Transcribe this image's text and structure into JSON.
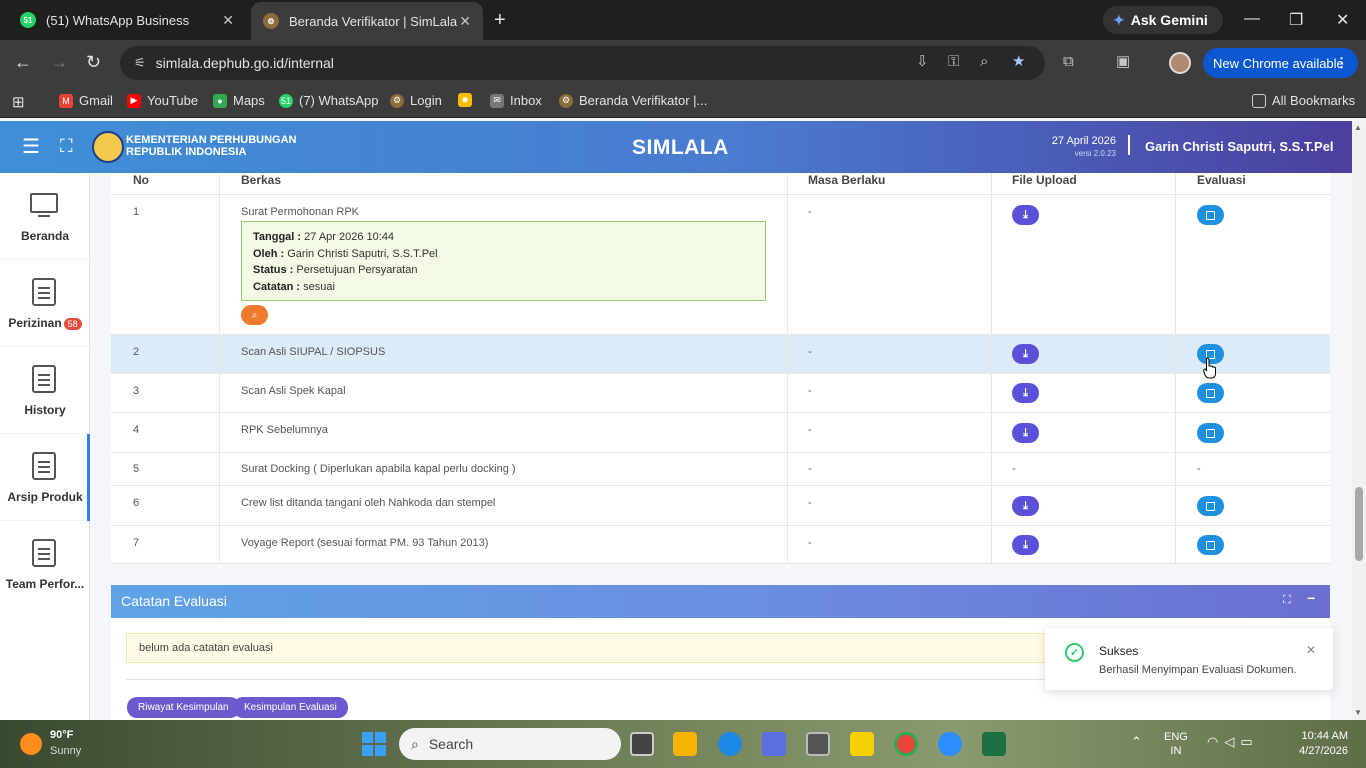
{
  "browser": {
    "tabs": [
      {
        "title": "(51) WhatsApp Business",
        "favicon_text": "51",
        "favicon_color": "#25d366"
      },
      {
        "title": "Beranda Verifikator | SimLala",
        "favicon_color": "#8a6d3b"
      }
    ],
    "ask_gemini": "Ask Gemini",
    "url": "simlala.dephub.go.id/internal",
    "update_label": "New Chrome available",
    "bookmarks": [
      {
        "label": "Gmail",
        "color": "#ea4335"
      },
      {
        "label": "YouTube",
        "color": "#ff0000"
      },
      {
        "label": "Maps",
        "color": "#34a853"
      },
      {
        "label": "(7) WhatsApp",
        "color": "#25d366",
        "badge": "51"
      },
      {
        "label": "Login",
        "color": "#8a6d3b"
      },
      {
        "label": "",
        "color": "#fbbc04"
      },
      {
        "label": "Inbox",
        "color": "#888888"
      },
      {
        "label": "Beranda Verifikator |...",
        "color": "#8a6d3b"
      }
    ],
    "all_bookmarks": "All Bookmarks"
  },
  "header": {
    "ministry_line1": "KEMENTERIAN PERHUBUNGAN",
    "ministry_line2": "REPUBLIK INDONESIA",
    "title": "SIMLALA",
    "date": "27 April 2026",
    "version": "versi 2.0.23",
    "user": "Garin Christi Saputri, S.S.T.Pel"
  },
  "sidebar": {
    "items": [
      {
        "label": "Beranda"
      },
      {
        "label": "Perizinan",
        "badge": "58"
      },
      {
        "label": "History"
      },
      {
        "label": "Arsip Produk"
      },
      {
        "label": "Team Perfor..."
      }
    ]
  },
  "table": {
    "columns": [
      "No",
      "Berkas",
      "Masa Berlaku",
      "File Upload",
      "Evaluasi"
    ],
    "rows": [
      {
        "no": "1",
        "berkas": "Surat Permohonan RPK",
        "masa": "-",
        "has_upload": true,
        "has_eval": true
      },
      {
        "no": "2",
        "berkas": "Scan Asli SIUPAL / SIOPSUS",
        "masa": "-",
        "has_upload": true,
        "has_eval": true
      },
      {
        "no": "3",
        "berkas": "Scan Asli Spek Kapal",
        "masa": "-",
        "has_upload": true,
        "has_eval": true
      },
      {
        "no": "4",
        "berkas": "RPK Sebelumnya",
        "masa": "-",
        "has_upload": true,
        "has_eval": true
      },
      {
        "no": "5",
        "berkas": "Surat Docking ( Diperlukan apabila kapal perlu docking )",
        "masa": "-",
        "upload_text": "-",
        "eval_text": "-"
      },
      {
        "no": "6",
        "berkas": "Crew list ditanda tangani oleh Nahkoda dan stempel",
        "masa": "-",
        "has_upload": true,
        "has_eval": true
      },
      {
        "no": "7",
        "berkas": "Voyage Report (sesuai format PM. 93 Tahun 2013)",
        "masa": "-",
        "has_upload": true,
        "has_eval": true
      }
    ],
    "info": {
      "tanggal_label": "Tanggal :",
      "tanggal_value": "27 Apr 2026 10:44",
      "oleh_label": "Oleh :",
      "oleh_value": "Garin Christi Saputri, S.S.T.Pel",
      "status_label": "Status :",
      "status_value": "Persetujuan Persyaratan",
      "catatan_label": "Catatan :",
      "catatan_value": "sesuai"
    }
  },
  "catatan": {
    "title": "Catatan Evaluasi",
    "note": "belum ada catatan evaluasi",
    "buttons": [
      "Riwayat Kesimpulan",
      "Kesimpulan Evaluasi"
    ]
  },
  "toast": {
    "title": "Sukses",
    "message": "Berhasil Menyimpan Evaluasi Dokumen."
  },
  "taskbar": {
    "weather_temp": "90°F",
    "weather_desc": "Sunny",
    "search_label": "Search",
    "lang_line1": "ENG",
    "lang_line2": "IN",
    "time": "10:44 AM",
    "date": "4/27/2026"
  }
}
